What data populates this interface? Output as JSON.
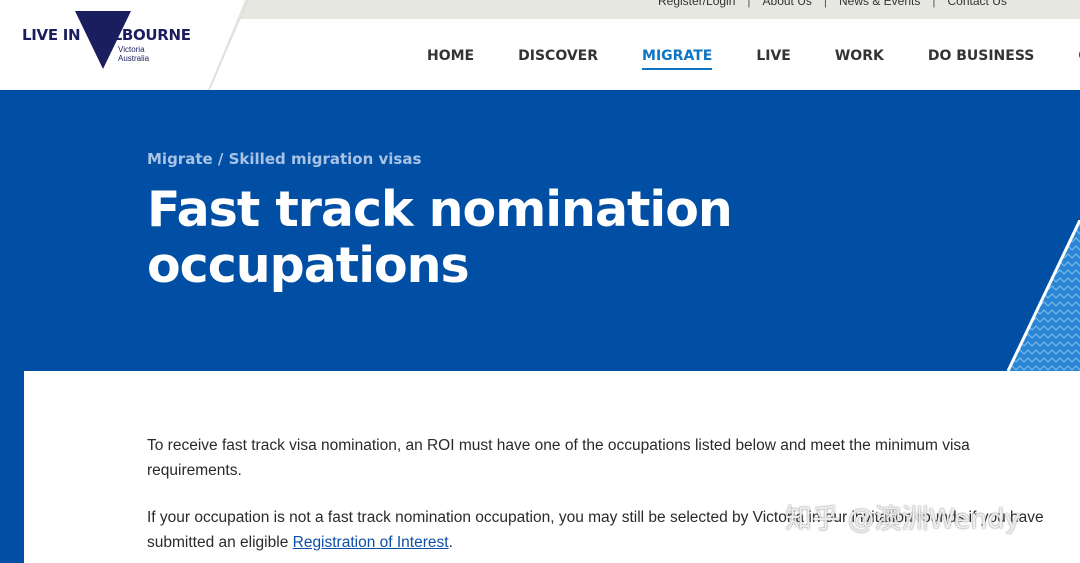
{
  "header": {
    "logo": {
      "text_left": "LIVE IN",
      "text_right": "MELBOURNE",
      "sub_line1": "Victoria",
      "sub_line2": "Australia"
    },
    "utility_links": [
      "Register/Login",
      "About Us",
      "News & Events",
      "Contact Us"
    ],
    "nav": [
      {
        "label": "HOME",
        "active": false
      },
      {
        "label": "DISCOVER",
        "active": false
      },
      {
        "label": "MIGRATE",
        "active": true
      },
      {
        "label": "LIVE",
        "active": false
      },
      {
        "label": "WORK",
        "active": false
      },
      {
        "label": "DO BUSINESS",
        "active": false
      },
      {
        "label": "CO",
        "active": false
      }
    ]
  },
  "hero": {
    "breadcrumb": [
      "Migrate",
      "Skilled migration visas"
    ],
    "breadcrumb_separator": " / ",
    "title": "Fast track nomination occupations"
  },
  "content": {
    "para1": "To receive fast track visa nomination, an ROI must have one of the occupations listed below and meet the minimum visa requirements.",
    "para2_before": "If your occupation is not a fast track nomination occupation, you may still be selected by Victoria in our invitation rounds if you have submitted an eligible ",
    "para2_link": "Registration of Interest",
    "para2_after": "."
  },
  "watermark": "知乎 @澳洲Wendy",
  "colors": {
    "hero_blue": "#004fa4",
    "nav_active": "#0e75c5",
    "logo_navy": "#1b1e5e",
    "link": "#0e4fa8"
  }
}
